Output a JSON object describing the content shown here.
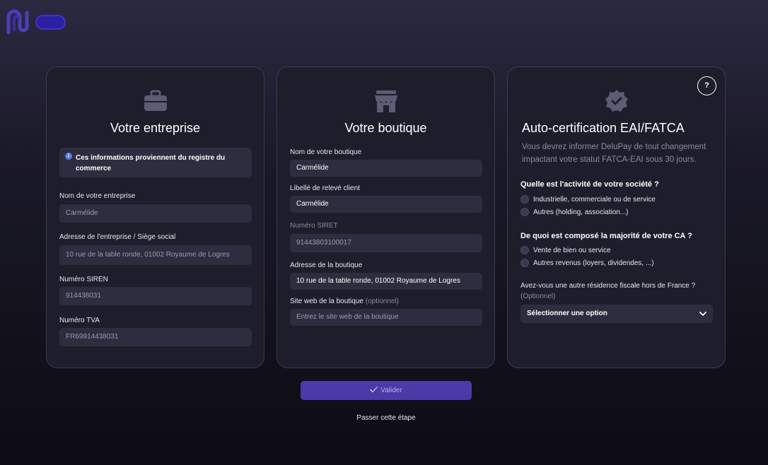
{
  "brand": {
    "logo_icon": "delupay-logo-icon",
    "accent": "#3e33c9",
    "button_color": "#4b3aa8"
  },
  "company": {
    "title": "Votre entreprise",
    "icon": "briefcase-icon",
    "info": "Ces informations proviennent du registre du commerce",
    "fields": [
      {
        "label": "Nom de votre entreprise",
        "value": "Carmélide"
      },
      {
        "label": "Adresse de l'entreprise / Siège social",
        "value": "10 rue de la table ronde, 01002 Royaume de Logres"
      },
      {
        "label": "Numéro SIREN",
        "value": "914438031"
      },
      {
        "label": "Numéro TVA",
        "value": "FR69914438031"
      }
    ]
  },
  "shop": {
    "title": "Votre boutique",
    "icon": "storefront-icon",
    "fields": [
      {
        "label": "Nom de votre boutique",
        "value": "Carmélide"
      },
      {
        "label": "Libellé de relevé client",
        "value": "Carmélide"
      },
      {
        "label": "Numéro SIRET",
        "value": "91443803100017"
      },
      {
        "label": "Adresse de la boutique",
        "value": "10 rue de la table ronde, 01002 Royaume de Logres"
      },
      {
        "label": "Site web de la boutique",
        "label_optional": "(optionnel)",
        "placeholder": "Entrez le site web de la boutique"
      }
    ]
  },
  "certification": {
    "title": "Auto-certification EAI/FATCA",
    "icon": "verified-badge-icon",
    "help": "?",
    "description": "Vous devrez informer DeluPay de tout changement impactant votre statut FATCA-EAI sous 30 jours.",
    "q1": {
      "label": "Quelle est l'activité de votre société ?",
      "options": [
        "Industrielle, commerciale ou de service",
        "Autres (holding, association...)"
      ]
    },
    "q2": {
      "label": "De quoi est composé la majorité de votre CA ?",
      "options": [
        "Vente de bien ou service",
        "Autres revenus (loyers, dividendes, ...)"
      ]
    },
    "q3": {
      "label": "Avez-vous une autre résidence fiscale hors de France ?",
      "sublabel": "(Optionnel)",
      "select_value": "Sélectionner une option"
    }
  },
  "actions": {
    "validate": "Valider",
    "skip": "Passer cette étape"
  }
}
